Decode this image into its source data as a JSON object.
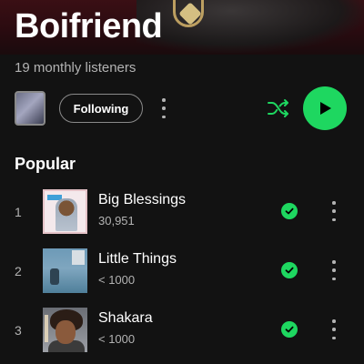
{
  "artist": {
    "name": "Boifriend",
    "monthly_listeners": "19 monthly listeners"
  },
  "controls": {
    "follow_label": "Following",
    "accent_color": "#1ed760"
  },
  "popular": {
    "title": "Popular",
    "tracks": [
      {
        "rank": "1",
        "title": "Big Blessings",
        "plays": "30,951"
      },
      {
        "rank": "2",
        "title": "Little Things",
        "plays": "< 1000"
      },
      {
        "rank": "3",
        "title": "Shakara",
        "plays": "< 1000"
      }
    ]
  },
  "icons": [
    "more-vertical-icon",
    "shuffle-icon",
    "play-icon",
    "downloaded-check-icon"
  ]
}
